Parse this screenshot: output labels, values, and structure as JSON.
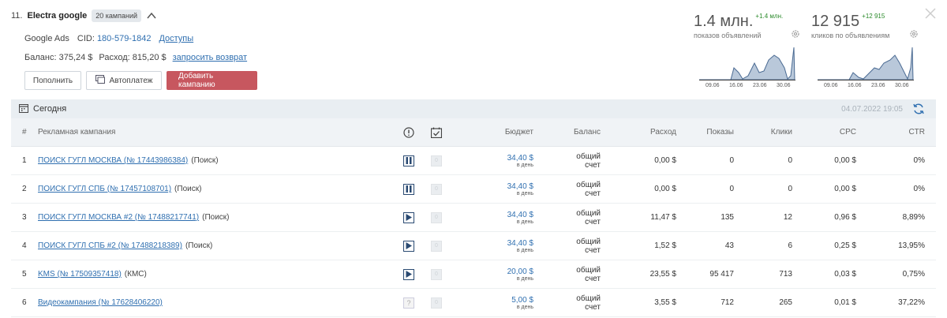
{
  "header": {
    "index": "11.",
    "name": "Electra google",
    "campaigns_badge": "20 кампаний"
  },
  "account": {
    "platform": "Google Ads",
    "cid_label": "CID:",
    "cid_value": "180-579-1842",
    "access_link": "Доступы",
    "balance_label": "Баланс:",
    "balance_value": "375,24 $",
    "spend_label": "Расход:",
    "spend_value": "815,20 $",
    "refund_link": "запросить возврат"
  },
  "buttons": {
    "topup": "Пополнить",
    "autopay": "Автоплатеж",
    "add_campaign": "Добавить кампанию"
  },
  "stats": [
    {
      "big": "1.4 млн.",
      "delta": "+1.4 млн.",
      "sub": "показов объявлений"
    },
    {
      "big": "12 915",
      "delta": "+12 915",
      "sub": "кликов по объявлениям"
    }
  ],
  "spark_ticks": [
    "09.06",
    "16.06",
    "23.06",
    "30.06"
  ],
  "toolbar": {
    "period": "Сегодня",
    "updated": "04.07.2022 19:05"
  },
  "table": {
    "headers": {
      "num": "#",
      "campaign": "Рекламная кампания",
      "budget": "Бюджет",
      "balance": "Баланс",
      "spend": "Расход",
      "impressions": "Показы",
      "clicks": "Клики",
      "cpc": "CPC",
      "ctr": "CTR"
    },
    "rows": [
      {
        "num": "1",
        "name": "ПОИСК ГУГЛ МОСКВА (№ 17443986384)",
        "type": "(Поиск)",
        "status": "pause",
        "budget": "34,40 $",
        "per": "в день",
        "balance": "общий счет",
        "spend": "0,00 $",
        "impressions": "0",
        "clicks": "0",
        "cpc": "0,00 $",
        "ctr": "0%"
      },
      {
        "num": "2",
        "name": "ПОИСК ГУГЛ СПБ (№ 17457108701)",
        "type": "(Поиск)",
        "status": "pause",
        "budget": "34,40 $",
        "per": "в день",
        "balance": "общий счет",
        "spend": "0,00 $",
        "impressions": "0",
        "clicks": "0",
        "cpc": "0,00 $",
        "ctr": "0%"
      },
      {
        "num": "3",
        "name": "ПОИСК ГУГЛ МОСКВА #2 (№ 17488217741)",
        "type": "(Поиск)",
        "status": "play",
        "budget": "34,40 $",
        "per": "в день",
        "balance": "общий счет",
        "spend": "11,47 $",
        "impressions": "135",
        "clicks": "12",
        "cpc": "0,96 $",
        "ctr": "8,89%"
      },
      {
        "num": "4",
        "name": "ПОИСК ГУГЛ СПБ #2 (№ 17488218389)",
        "type": "(Поиск)",
        "status": "play",
        "budget": "34,40 $",
        "per": "в день",
        "balance": "общий счет",
        "spend": "1,52 $",
        "impressions": "43",
        "clicks": "6",
        "cpc": "0,25 $",
        "ctr": "13,95%"
      },
      {
        "num": "5",
        "name": "KMS (№ 17509357418)",
        "type": "(КМС)",
        "status": "play",
        "budget": "20,00 $",
        "per": "в день",
        "balance": "общий счет",
        "spend": "23,55 $",
        "impressions": "95 417",
        "clicks": "713",
        "cpc": "0,03 $",
        "ctr": "0,75%"
      },
      {
        "num": "6",
        "name": "Видеокампания (№ 17628406220)",
        "type": "",
        "status": "unknown",
        "budget": "5,00 $",
        "per": "в день",
        "balance": "общий счет",
        "spend": "3,55 $",
        "impressions": "712",
        "clicks": "265",
        "cpc": "0,01 $",
        "ctr": "37,22%"
      }
    ]
  },
  "colors": {
    "accent_button": "#c7575f",
    "link": "#2f6fb0",
    "delta_green": "#2a8a2a"
  }
}
